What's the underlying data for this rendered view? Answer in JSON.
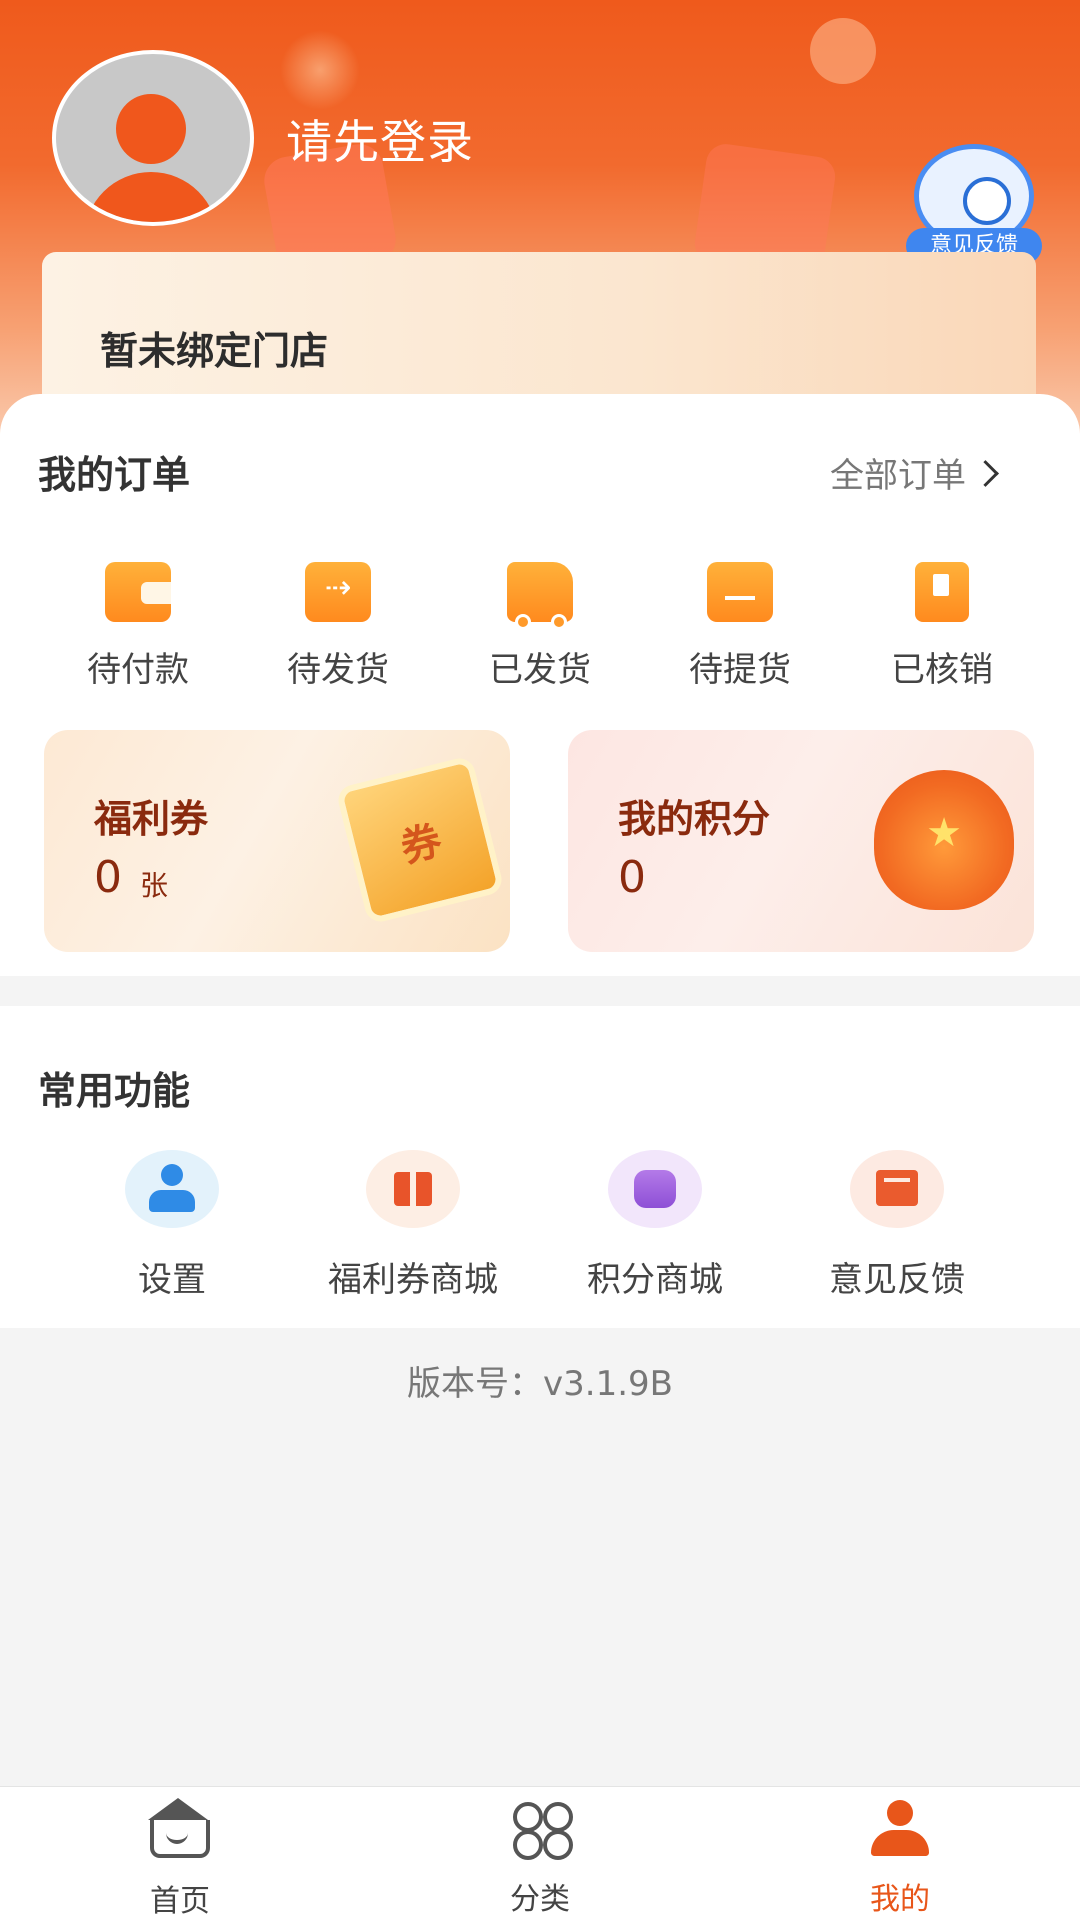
{
  "header": {
    "login_prompt": "请先登录",
    "feedback_badge": "意见反馈",
    "store_status": "暂未绑定门店"
  },
  "orders": {
    "title": "我的订单",
    "all_orders_link": "全部订单",
    "items": [
      {
        "label": "待付款",
        "icon": "wallet-icon"
      },
      {
        "label": "待发货",
        "icon": "box-arrow-icon"
      },
      {
        "label": "已发货",
        "icon": "truck-icon"
      },
      {
        "label": "待提货",
        "icon": "pickup-box-icon"
      },
      {
        "label": "已核销",
        "icon": "verified-doc-icon"
      }
    ]
  },
  "promos": {
    "coupon": {
      "title": "福利券",
      "value": "0",
      "unit": "张",
      "art_text": "券"
    },
    "points": {
      "title": "我的积分",
      "value": "0",
      "art_text": "★"
    }
  },
  "functions": {
    "title": "常用功能",
    "items": [
      {
        "label": "设置",
        "icon": "user-settings-icon"
      },
      {
        "label": "福利券商城",
        "icon": "gift-icon"
      },
      {
        "label": "积分商城",
        "icon": "coin-stack-icon"
      },
      {
        "label": "意见反馈",
        "icon": "mail-icon"
      }
    ]
  },
  "version": "版本号：v3.1.9B",
  "tabbar": {
    "items": [
      {
        "label": "首页",
        "icon": "home-icon",
        "active": false
      },
      {
        "label": "分类",
        "icon": "category-icon",
        "active": false
      },
      {
        "label": "我的",
        "icon": "profile-icon",
        "active": true
      }
    ]
  },
  "colors": {
    "brand": "#ef5a1c",
    "active_tab": "#e8561a",
    "promo_text": "#8a2a0e",
    "feedback_blue": "#3f86ef"
  }
}
